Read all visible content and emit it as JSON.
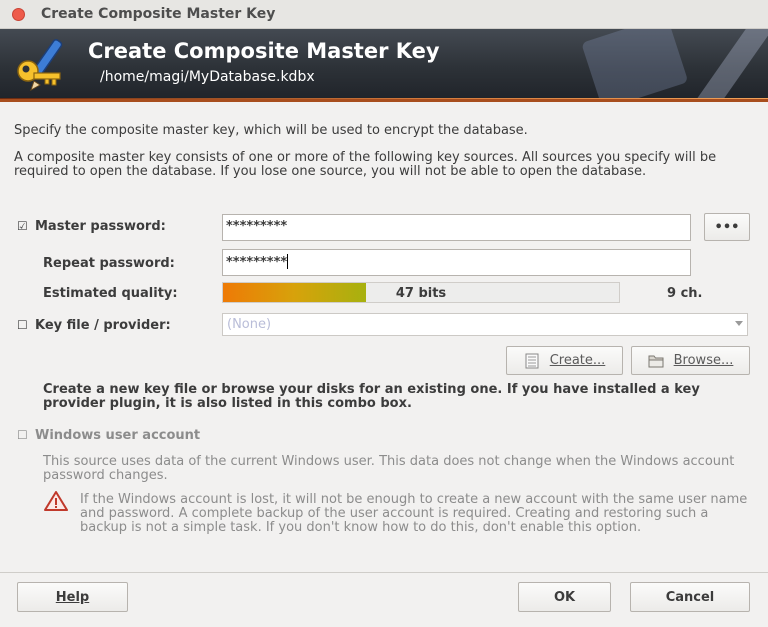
{
  "window": {
    "title": "Create Composite Master Key"
  },
  "banner": {
    "heading": "Create Composite Master Key",
    "path": "/home/magi/MyDatabase.kdbx"
  },
  "intro": {
    "line1": "Specify the composite master key, which will be used to encrypt the database.",
    "line2": "A composite master key consists of one or more of the following key sources. All sources you specify will be required to open the database.  If you lose one source, you will not be able to open the database."
  },
  "master_password": {
    "checked": true,
    "check_glyph": "☑",
    "label": "Master password:",
    "value": "*********",
    "toggle_label": "•••"
  },
  "repeat_password": {
    "label": "Repeat password:",
    "value": "*********"
  },
  "quality": {
    "label": "Estimated quality:",
    "bits_text": "47 bits",
    "fill_fraction": 0.36,
    "chars_text": "9 ch."
  },
  "key_file": {
    "checked": false,
    "check_glyph": "☐",
    "label": "Key file / provider:",
    "selected": "(None)",
    "create_label": "Create...",
    "browse_label": "Browse...",
    "hint": "Create a new key file or browse your disks for an existing one. If you have installed a key provider plugin, it is also listed in this combo box."
  },
  "windows_account": {
    "checked": false,
    "check_glyph": "☐",
    "label": "Windows user account",
    "description": "This source uses data of the current Windows user. This data does not change when the Windows account password changes.",
    "warning": "If the Windows account is lost, it will not be enough to create a new account with the same user name and password. A complete backup of the user account is required. Creating and restoring such a backup is not a simple task. If you don't know how to do this, don't enable this option."
  },
  "footer": {
    "help_label": "Help",
    "ok_label": "OK",
    "cancel_label": "Cancel"
  },
  "colors": {
    "accent_orange": "#ee7a06",
    "banner_dark": "#2d3238",
    "close_red": "#ee5b4b"
  },
  "icons": {
    "banner": "key-pen-icon",
    "create": "key-file-icon",
    "browse": "folder-icon",
    "warning": "warning-icon"
  }
}
